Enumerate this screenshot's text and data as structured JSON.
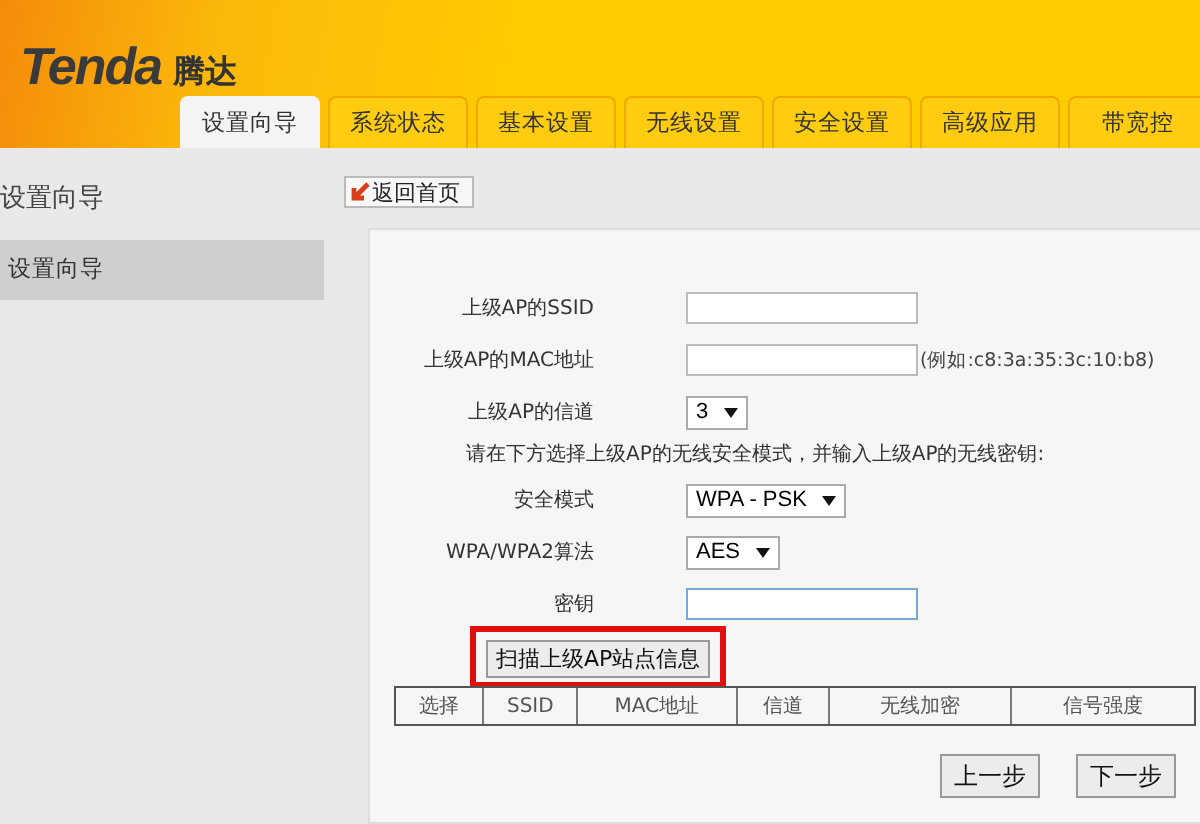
{
  "header": {
    "logo": "Tenda",
    "logo_cn": "腾达"
  },
  "tabs": [
    {
      "label": "设置向导",
      "selected": true
    },
    {
      "label": "系统状态",
      "selected": false
    },
    {
      "label": "基本设置",
      "selected": false
    },
    {
      "label": "无线设置",
      "selected": false
    },
    {
      "label": "安全设置",
      "selected": false
    },
    {
      "label": "高级应用",
      "selected": false
    },
    {
      "label": "带宽控",
      "selected": false
    }
  ],
  "sidebar": {
    "title": "设置向导",
    "items": [
      {
        "label": "设置向导",
        "selected": true
      }
    ]
  },
  "back_button": "返回首页",
  "form": {
    "fields": [
      {
        "kind": "input",
        "label": "上级AP的SSID"
      },
      {
        "kind": "input",
        "label": "上级AP的MAC地址",
        "hint": "(例如:c8:3a:35:3c:10:b8)"
      },
      {
        "kind": "select",
        "label": "上级AP的信道",
        "value": "3"
      },
      {
        "kind": "note",
        "label": "请在下方选择上级AP的无线安全模式，并输入上级AP的无线密钥:"
      },
      {
        "kind": "select",
        "label": "安全模式",
        "value": "WPA - PSK"
      },
      {
        "kind": "select",
        "label": "WPA/WPA2算法",
        "value": "AES"
      },
      {
        "kind": "input",
        "label": "密钥",
        "focused": true
      }
    ],
    "scan_button": "扫描上级AP站点信息",
    "table": {
      "columns": [
        "选择",
        "SSID",
        "MAC地址",
        "信道",
        "无线加密",
        "信号强度"
      ]
    },
    "buttons": [
      "上一步",
      "下一步"
    ]
  }
}
